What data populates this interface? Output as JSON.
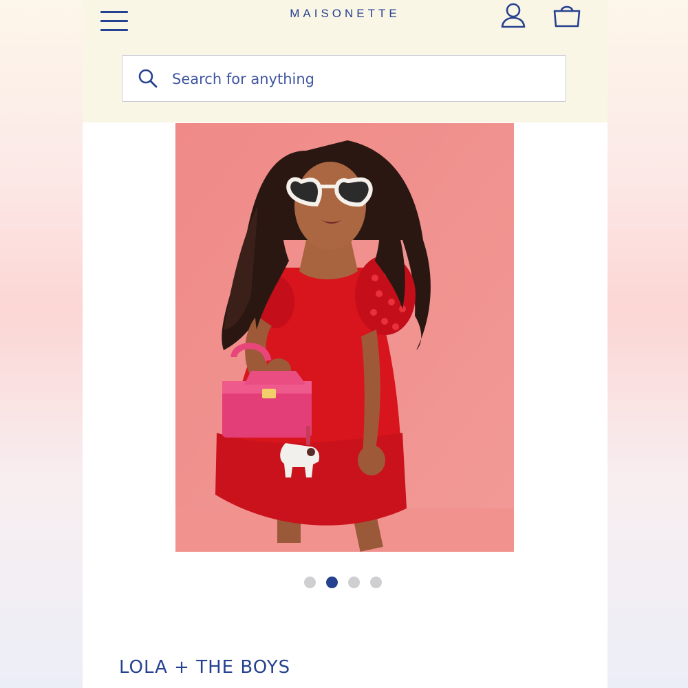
{
  "header": {
    "brand": "MAISONETTE",
    "menu_icon": "hamburger-menu-icon",
    "account_icon": "user-icon",
    "bag_icon": "shopping-bag-icon"
  },
  "search": {
    "placeholder": "Search for anything",
    "icon": "search-icon"
  },
  "product": {
    "image_description_icon": "product-photo",
    "brand_name": "LOLA + THE BOYS"
  },
  "carousel": {
    "total": 4,
    "active_index": 1
  },
  "colors": {
    "accent": "#26418f",
    "header_bg": "#faf6e6",
    "photo_bg": "#f08f8e",
    "dress": "#d8141d",
    "dot_inactive": "#cfcfd1"
  }
}
